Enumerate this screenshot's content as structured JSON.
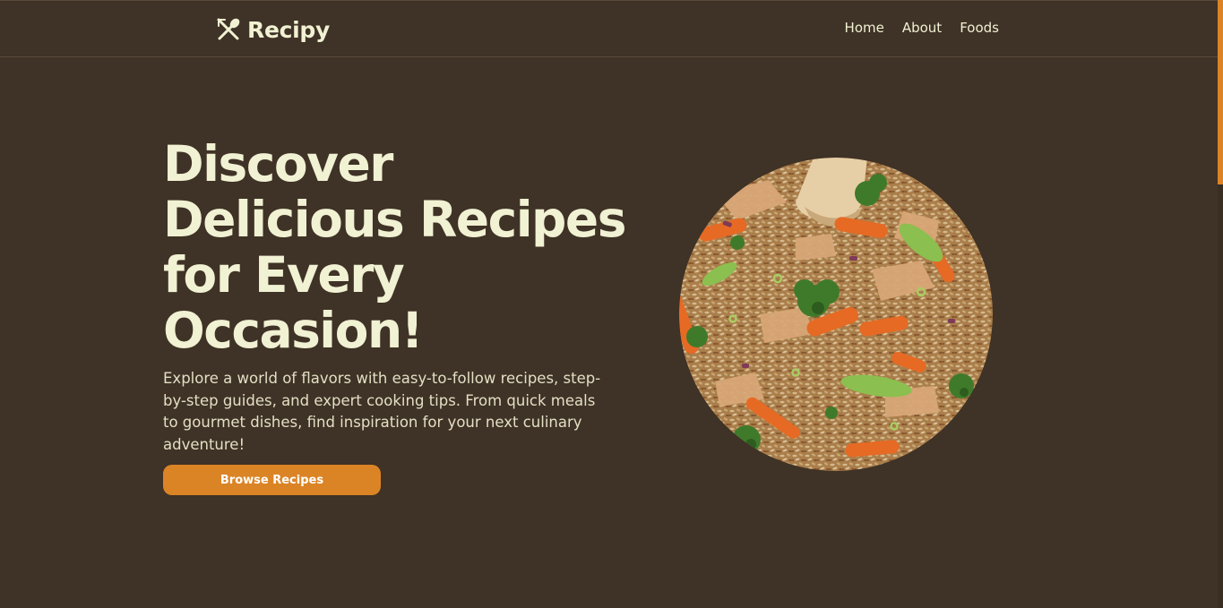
{
  "brand": {
    "name": "Recipy",
    "icon": "utensils-crossed-icon"
  },
  "nav": {
    "links": [
      "Home",
      "About",
      "Foods"
    ]
  },
  "hero": {
    "title": "Discover Delicious Recipes for Every Occasion!",
    "description": "Explore a world of flavors with easy-to-follow recipes, step-by-step guides, and expert cooking tips. From quick meals to gourmet dishes, find inspiration for your next culinary adventure!",
    "button_label": "Browse Recipes",
    "image": "fried-rice-photo"
  },
  "colors": {
    "background": "#3f3226",
    "accent": "#db8426",
    "text": "#f1f1d3"
  }
}
